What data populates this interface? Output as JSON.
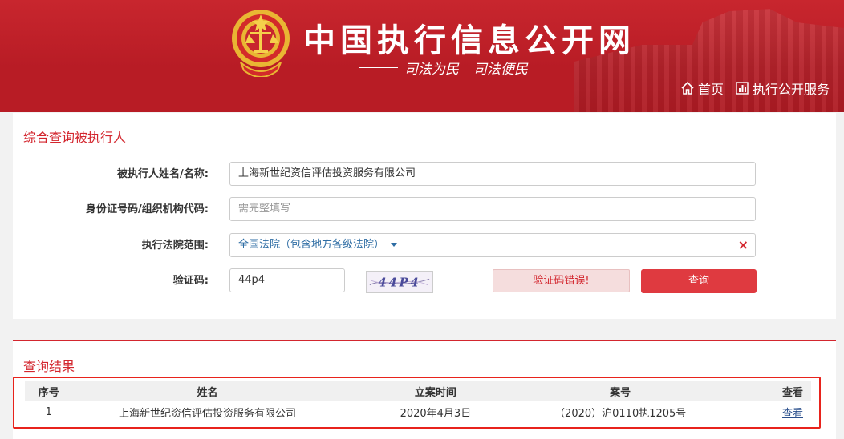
{
  "header": {
    "site_title": "中国执行信息公开网",
    "slogan_left": "司法为民",
    "slogan_right": "司法便民",
    "nav": [
      {
        "label": "首页",
        "icon": "home-icon"
      },
      {
        "label": "执行公开服务",
        "icon": "bar-chart-icon"
      }
    ]
  },
  "search": {
    "title": "综合查询被执行人",
    "name_label": "被执行人姓名/名称:",
    "name_value": "上海新世纪资信评估投资服务有限公司",
    "id_label": "身份证号码/组织机构代码:",
    "id_placeholder": "需完整填写",
    "court_label": "执行法院范围:",
    "court_value": "全国法院（包含地方各级法院）",
    "clear_symbol": "×",
    "captcha_label": "验证码:",
    "captcha_value": "44p4",
    "captcha_image_text": "44P4",
    "captcha_error": "验证码错误!",
    "query_button": "查询"
  },
  "results": {
    "title": "查询结果",
    "columns": [
      "序号",
      "姓名",
      "立案时间",
      "案号",
      "查看"
    ],
    "rows": [
      {
        "index": "1",
        "name": "上海新世纪资信评估投资服务有限公司",
        "date": "2020年4月3日",
        "case_no": "（2020）沪0110执1205号",
        "view": "查看"
      }
    ]
  },
  "colors": {
    "header_red": "#c8262e",
    "accent_red": "#d3262e",
    "button_red": "#df3a40",
    "highlight_box": "#e8231c"
  }
}
